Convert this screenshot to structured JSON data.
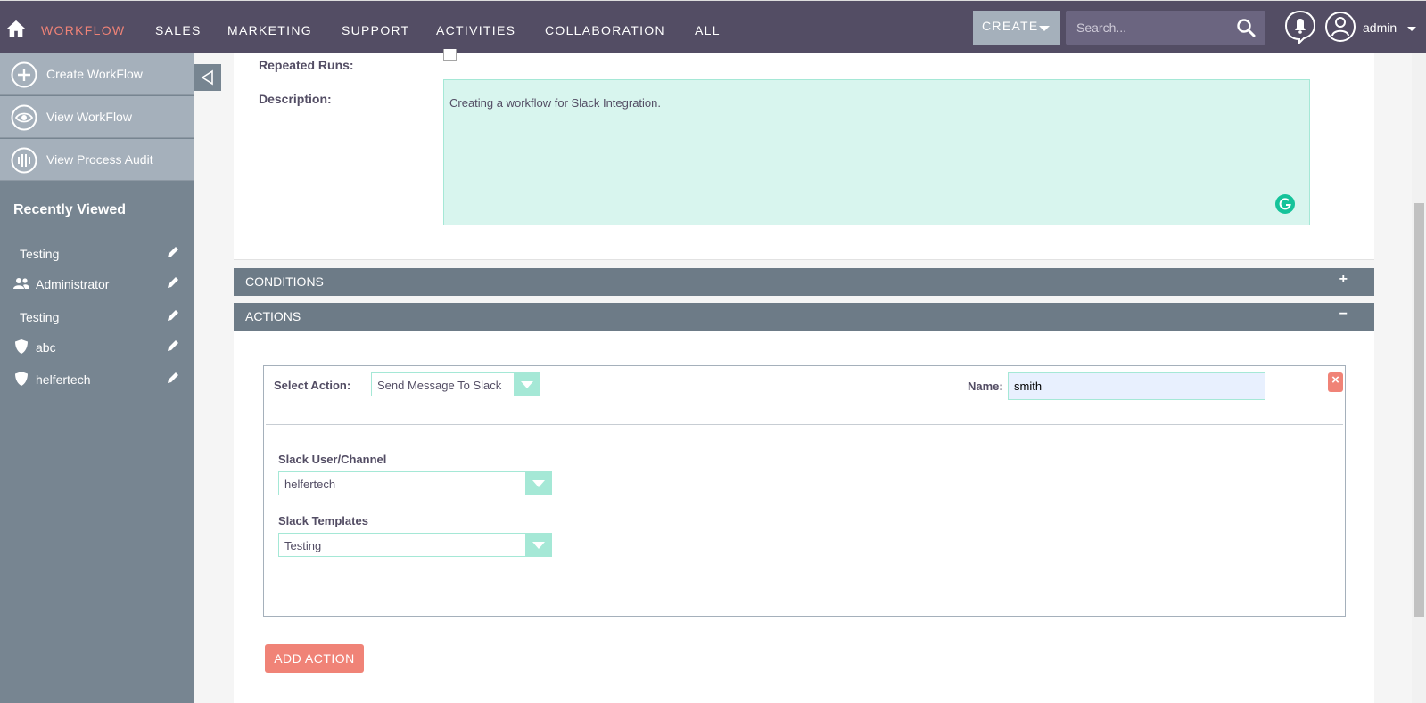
{
  "nav": {
    "items": [
      "WORKFLOW",
      "SALES",
      "MARKETING",
      "SUPPORT",
      "ACTIVITIES",
      "COLLABORATION",
      "ALL"
    ],
    "create_label": "CREATE",
    "search_placeholder": "Search...",
    "user_name": "admin"
  },
  "sidebar": {
    "actions": [
      "Create WorkFlow",
      "View WorkFlow",
      "View Process Audit"
    ],
    "recent_title": "Recently Viewed",
    "recent_items": [
      "Testing",
      "Administrator",
      "Testing",
      "abc",
      "helfertech"
    ]
  },
  "form": {
    "repeated_runs_label": "Repeated Runs:",
    "description_label": "Description:",
    "description_value": "Creating a workflow for Slack Integration."
  },
  "sections": {
    "conditions": "CONDITIONS",
    "conditions_toggle": "+",
    "actions": "ACTIONS",
    "actions_toggle": "−"
  },
  "action": {
    "select_label": "Select Action:",
    "select_value": "Send Message To Slack",
    "name_label": "Name:",
    "name_value": "smith",
    "remove_label": "×",
    "slack_user_label": "Slack User/Channel",
    "slack_user_value": "helfertech",
    "slack_templates_label": "Slack Templates",
    "slack_templates_value": "Testing",
    "add_action_label": "ADD ACTION"
  },
  "colors": {
    "nav_bg": "#534d64",
    "accent": "#f08377",
    "sidebar_bg": "#778591",
    "section_bar": "#6d7b87",
    "field_bg": "#d8f5ee"
  }
}
